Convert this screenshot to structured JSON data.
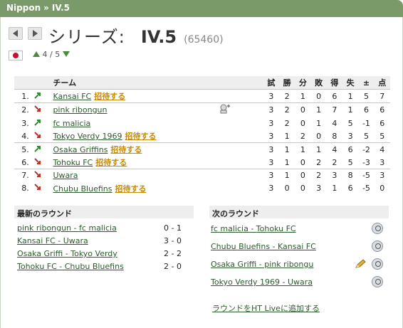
{
  "breadcrumb": {
    "country": "Nippon",
    "separator": "»",
    "league": "IV.5"
  },
  "title": {
    "series_label": "シリーズ:",
    "league": "IV.5",
    "league_id": "(65460)"
  },
  "rank_nav": {
    "current": "4",
    "separator": "/",
    "total": "5"
  },
  "table": {
    "headers": {
      "team": "チーム",
      "played": "試",
      "won": "勝",
      "drawn": "分",
      "lost": "敗",
      "goals_for": "得",
      "goals_against": "失",
      "goal_diff": "±",
      "points": "点"
    },
    "rows": [
      {
        "pos": "1.",
        "move": "up",
        "team": "Kansai FC",
        "invite": "招待する",
        "played": "3",
        "won": "2",
        "drawn": "1",
        "lost": "0",
        "gf": "6",
        "ga": "1",
        "gd": "5",
        "pts": "7"
      },
      {
        "pos": "2.",
        "move": "down",
        "team": "pink ribongun",
        "invite": "",
        "played": "3",
        "won": "2",
        "drawn": "0",
        "lost": "1",
        "gf": "7",
        "ga": "1",
        "gd": "6",
        "pts": "6"
      },
      {
        "pos": "3.",
        "move": "up",
        "team": "fc malicia",
        "invite": "",
        "played": "3",
        "won": "2",
        "drawn": "0",
        "lost": "1",
        "gf": "4",
        "ga": "5",
        "gd": "-1",
        "pts": "6"
      },
      {
        "pos": "4.",
        "move": "down",
        "team": "Tokyo Verdy 1969",
        "invite": "招待する",
        "played": "3",
        "won": "1",
        "drawn": "2",
        "lost": "0",
        "gf": "8",
        "ga": "3",
        "gd": "5",
        "pts": "5"
      },
      {
        "pos": "5.",
        "move": "up",
        "team": "Osaka Griffins",
        "invite": "招待する",
        "played": "3",
        "won": "1",
        "drawn": "1",
        "lost": "1",
        "gf": "4",
        "ga": "6",
        "gd": "-2",
        "pts": "4"
      },
      {
        "pos": "6.",
        "move": "down",
        "team": "Tohoku FC",
        "invite": "招待する",
        "played": "3",
        "won": "1",
        "drawn": "0",
        "lost": "2",
        "gf": "2",
        "ga": "5",
        "gd": "-3",
        "pts": "3"
      },
      {
        "pos": "7.",
        "move": "down",
        "team": "Uwara",
        "invite": "",
        "played": "3",
        "won": "1",
        "drawn": "0",
        "lost": "2",
        "gf": "3",
        "ga": "8",
        "gd": "-5",
        "pts": "3"
      },
      {
        "pos": "8.",
        "move": "down",
        "team": "Chubu Bluefins",
        "invite": "招待する",
        "played": "3",
        "won": "0",
        "drawn": "0",
        "lost": "3",
        "gf": "1",
        "ga": "6",
        "gd": "-5",
        "pts": "0"
      }
    ]
  },
  "latest_round": {
    "title": "最新のラウンド",
    "matches": [
      {
        "match": "pink ribongun - fc malicia",
        "score": "0 - 1"
      },
      {
        "match": "Kansai FC - Uwara",
        "score": "3 - 0"
      },
      {
        "match": "Osaka Griffi - Tokyo Verdy",
        "score": "2 - 2"
      },
      {
        "match": "Tohoku FC - Chubu Bluefins",
        "score": "2 - 0"
      }
    ]
  },
  "next_round": {
    "title": "次のラウンド",
    "matches": [
      {
        "match": "fc malicia - Tohoku FC"
      },
      {
        "match": "Chubu Bluefins - Kansai FC"
      },
      {
        "match": "Osaka Griffi - pink ribongu"
      },
      {
        "match": "Tokyo Verdy 1969 - Uwara"
      }
    ],
    "live_link": "ラウンドをHT Liveに追加する"
  },
  "colors": {
    "header_bar": "#7a9a6a",
    "link": "#2c5a2c",
    "invite": "#c88a00",
    "up_arrow": "#2e8b2e",
    "down_arrow": "#c0302a"
  }
}
